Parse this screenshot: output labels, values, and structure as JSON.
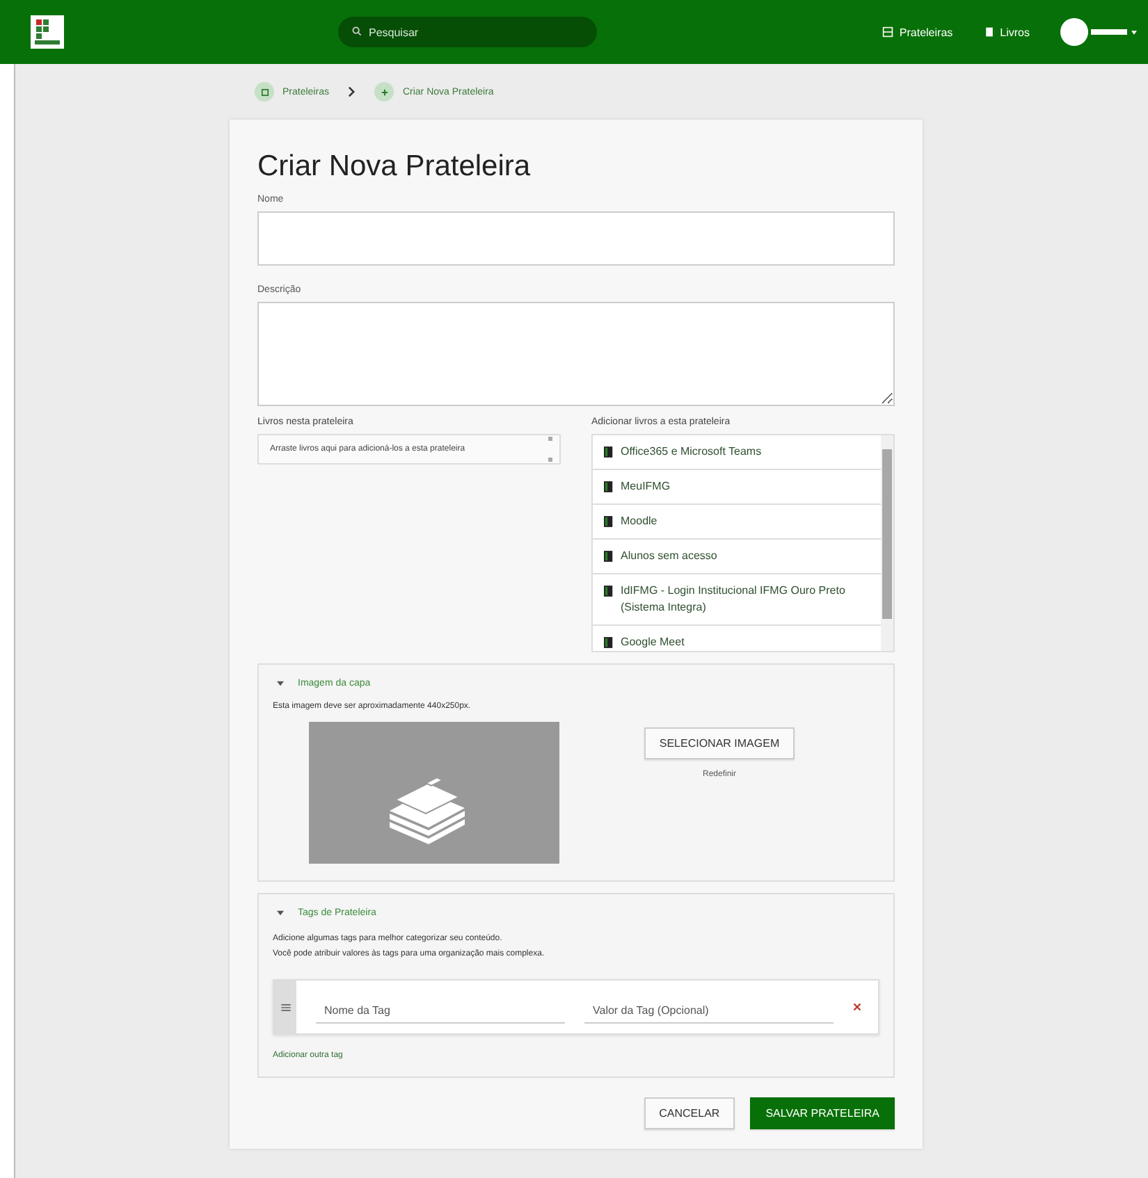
{
  "header": {
    "search": {
      "placeholder": "Pesquisar"
    },
    "nav": [
      {
        "label": "Prateleiras",
        "kind": "shelf"
      },
      {
        "label": "Livros",
        "kind": "book"
      }
    ]
  },
  "breadcrumb": [
    {
      "label": "Prateleiras",
      "kind": "shelf"
    },
    {
      "label": "Criar Nova Prateleira",
      "kind": "add"
    }
  ],
  "form": {
    "title": "Criar Nova Prateleira",
    "name_field": {
      "label": "Nome"
    },
    "description_field": {
      "label": "Descrição"
    },
    "shelf_books": {
      "label": "Livros nesta prateleira",
      "placeholder": "Arraste livros aqui para adicioná-los a esta prateleira"
    },
    "available_books": {
      "label": "Adicionar livros a esta prateleira",
      "items": [
        {
          "title": "Office365 e Microsoft Teams"
        },
        {
          "title": "MeuIFMG"
        },
        {
          "title": "Moodle"
        },
        {
          "title": "Alunos sem acesso"
        },
        {
          "title": "IdIFMG - Login Institucional IFMG Ouro Preto (Sistema Integra)"
        },
        {
          "title": "Google Meet"
        }
      ]
    },
    "cover": {
      "heading": "Imagem da capa",
      "expanded": true,
      "hint": "Esta imagem deve ser aproximadamente 440x250px.",
      "select_button": "SELECIONAR IMAGEM",
      "reset_link": "Redefinir"
    },
    "tags": {
      "heading": "Tags de Prateleira",
      "expanded": true,
      "hint_lines": [
        "Adicione algumas tags para melhor categorizar seu conteúdo.",
        "Você pode atribuir valores às tags para uma organização mais complexa."
      ],
      "rows": [
        {
          "name_placeholder": "Nome da Tag",
          "value_placeholder": "Valor da Tag (Opcional)"
        }
      ],
      "add_link": "Adicionar outra tag"
    },
    "buttons": {
      "cancel": "CANCELAR",
      "save": "SALVAR PRATELEIRA"
    }
  }
}
